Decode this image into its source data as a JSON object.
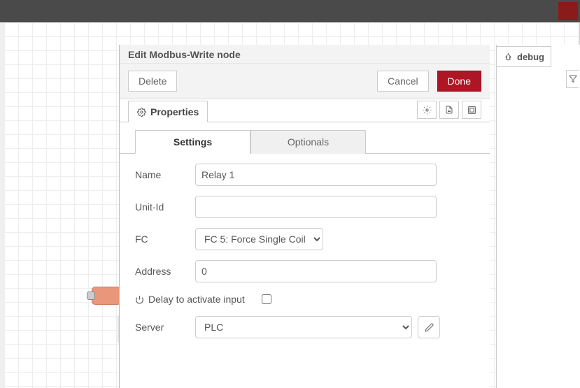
{
  "header": {
    "title": "Edit Modbus-Write node"
  },
  "toolbar": {
    "delete_label": "Delete",
    "cancel_label": "Cancel",
    "done_label": "Done"
  },
  "properties_tab": {
    "label": "Properties"
  },
  "inner_tabs": {
    "settings": "Settings",
    "optionals": "Optionals"
  },
  "form": {
    "name_label": "Name",
    "name_value": "Relay 1",
    "unitid_label": "Unit-Id",
    "unitid_value": "",
    "fc_label": "FC",
    "fc_value": "FC 5: Force Single Coil",
    "address_label": "Address",
    "address_value": "0",
    "delay_label": "Delay to activate input",
    "delay_checked": false,
    "server_label": "Server",
    "server_value": "PLC"
  },
  "sidebar": {
    "debug_label": "debug"
  }
}
